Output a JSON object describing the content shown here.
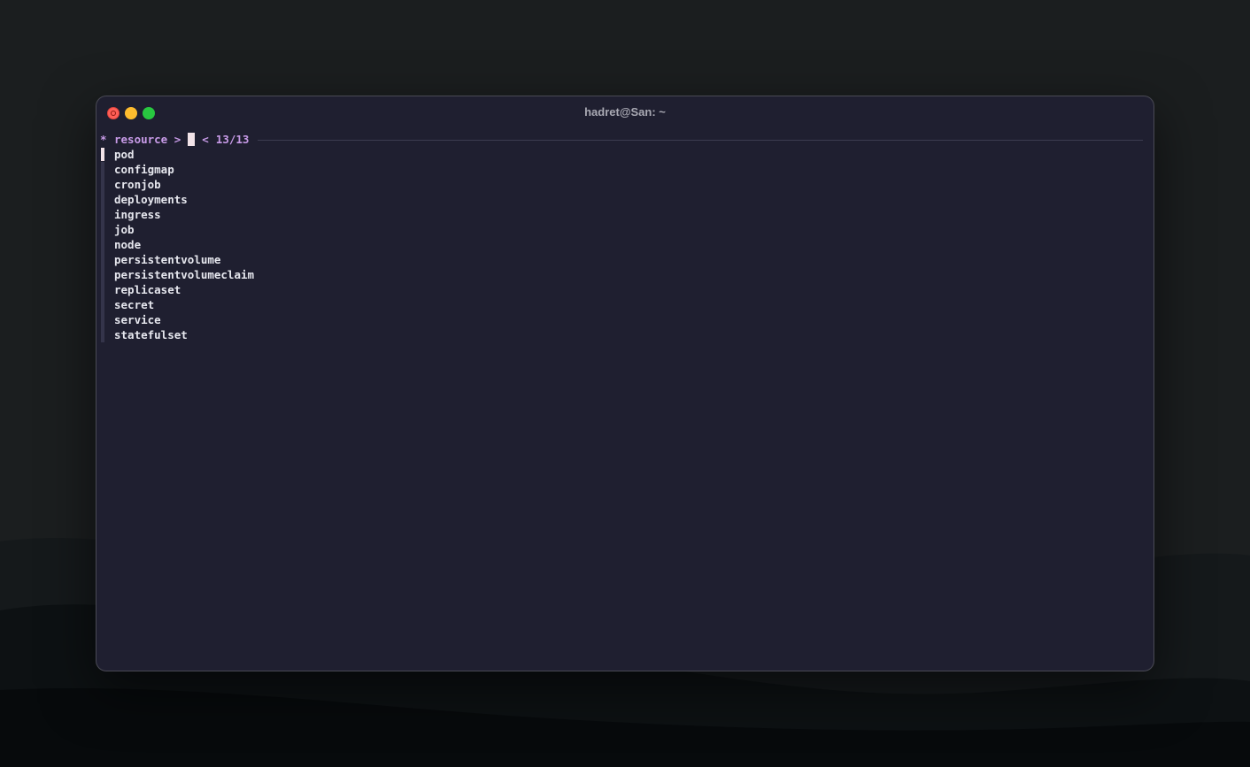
{
  "window": {
    "title": "hadret@San: ~"
  },
  "prompt": {
    "marker": "*",
    "label": "resource >",
    "counter_arrow": "<",
    "counter": "13/13"
  },
  "list": {
    "selected_index": 0,
    "items": [
      {
        "label": "pod"
      },
      {
        "label": "configmap"
      },
      {
        "label": "cronjob"
      },
      {
        "label": "deployments"
      },
      {
        "label": "ingress"
      },
      {
        "label": "job"
      },
      {
        "label": "node"
      },
      {
        "label": "persistentvolume"
      },
      {
        "label": "persistentvolumeclaim"
      },
      {
        "label": "replicaset"
      },
      {
        "label": "secret"
      },
      {
        "label": "service"
      },
      {
        "label": "statefulset"
      }
    ]
  },
  "colors": {
    "background": "#1f1f30",
    "accent": "#c89be8",
    "text": "#e6e7ee",
    "cursor": "#f2e3e8",
    "close": "#ff5f57",
    "minimize": "#febc2e",
    "maximize": "#28c840"
  }
}
